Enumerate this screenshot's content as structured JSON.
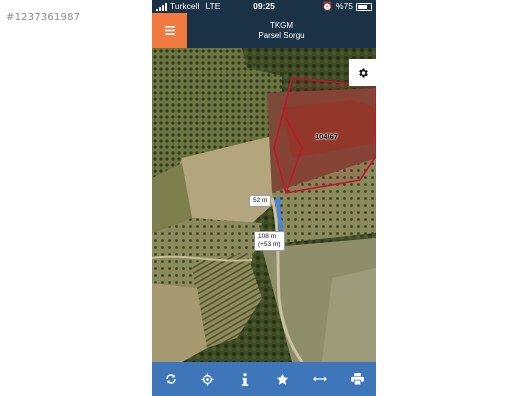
{
  "watermark": "#1237361987",
  "status": {
    "carrier": "Turkcell",
    "network": "LTE",
    "time": "09:25",
    "battery": "%75"
  },
  "header": {
    "title": "TKGM",
    "subtitle": "Parsel Sorgu"
  },
  "map": {
    "parcel_label": "104/67",
    "measure_segment": "52 m",
    "measure_total_line1": "108 m",
    "measure_total_line2": "(+53 m)"
  },
  "colors": {
    "header_bg": "#1b3146",
    "menu_button": "#f07a3f",
    "toolbar_bg": "#3f76b9",
    "parcel_border": "#c8102e",
    "measure_line": "#3a86ff"
  },
  "toolbar": {
    "icons": [
      "refresh-icon",
      "locate-icon",
      "info-icon",
      "star-icon",
      "measure-icon",
      "print-icon"
    ]
  }
}
